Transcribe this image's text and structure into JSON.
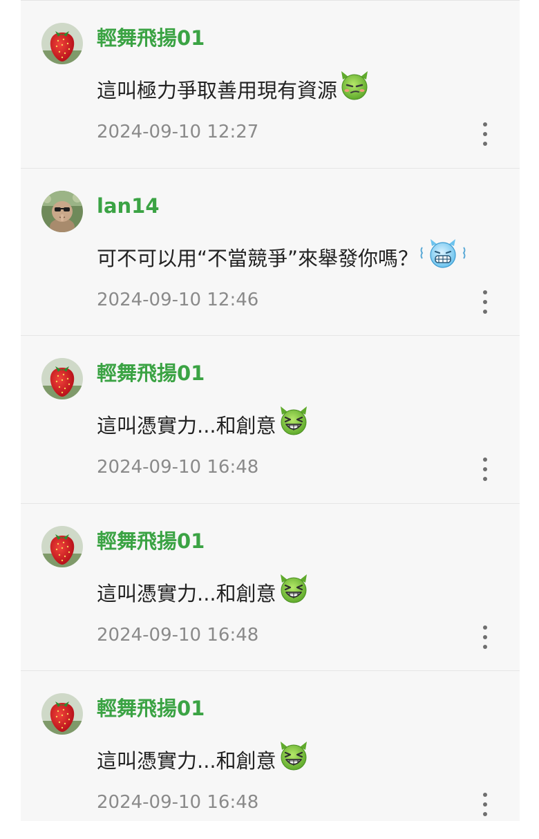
{
  "comments": [
    {
      "username": "輕舞飛揚01",
      "avatar": "strawberry-avatar",
      "text": "這叫極力爭取善用現有資源",
      "emoticon": "smirk-devil-emoticon",
      "timestamp": "2024-09-10 12:27"
    },
    {
      "username": "lan14",
      "avatar": "baby-with-sunglasses-avatar",
      "text": "可不可以用“不當競爭”來舉發你嗎？",
      "emoticon": "shivering-blue-devil-emoticon",
      "timestamp": "2024-09-10 12:46"
    },
    {
      "username": "輕舞飛揚01",
      "avatar": "strawberry-avatar",
      "text": "這叫憑實力...和創意",
      "emoticon": "grinning-devil-emoticon",
      "timestamp": "2024-09-10 16:48"
    },
    {
      "username": "輕舞飛揚01",
      "avatar": "strawberry-avatar",
      "text": "這叫憑實力...和創意",
      "emoticon": "grinning-devil-emoticon",
      "timestamp": "2024-09-10 16:48"
    },
    {
      "username": "輕舞飛揚01",
      "avatar": "strawberry-avatar",
      "text": "這叫憑實力...和創意",
      "emoticon": "grinning-devil-emoticon",
      "timestamp": "2024-09-10 16:48"
    }
  ],
  "colors": {
    "username": "#3ba344",
    "text": "#222222",
    "timestamp": "#8a8a8a",
    "background": "#f7f7f7",
    "divider": "#e6e6e6"
  },
  "icons": {
    "more": "vertical-ellipsis-icon"
  }
}
